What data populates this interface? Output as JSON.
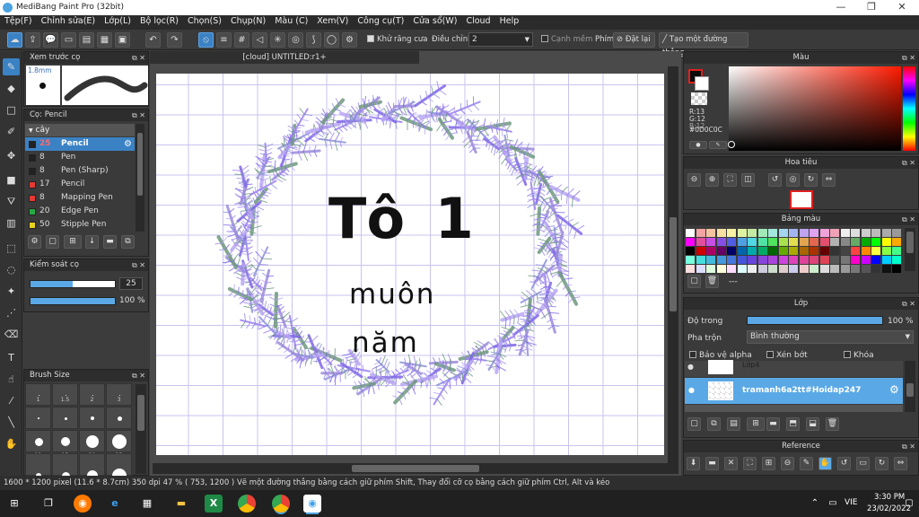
{
  "title_bar": {
    "title": "MediBang Paint Pro (32bit)",
    "minimize": "—",
    "maximize": "❐",
    "close": "✕"
  },
  "menu": [
    "Tệp(F)",
    "Chỉnh sửa(E)",
    "Lớp(L)",
    "Bộ lọc(R)",
    "Chọn(S)",
    "Chụp(N)",
    "Màu (C)",
    "Xem(V)",
    "Công cụ(T)",
    "Cửa sổ(W)",
    "Cloud",
    "Help"
  ],
  "toolbar": {
    "antialias": "Khử răng cưa",
    "adjust_label": "Điều chỉnh",
    "adjust_value": "2",
    "edge": "Cạnh mềm",
    "key_label": "Phím",
    "reset": "Đặt lại",
    "new_line": "Tạo một đường thẳng"
  },
  "preview_panel": {
    "title": "Xem trước cọ",
    "size": "1.8mm"
  },
  "brush_panel": {
    "title": "Cọ: Pencil",
    "group": "cây",
    "items": [
      {
        "size": "25",
        "name": "Pencil",
        "color": "#222222",
        "selected": true
      },
      {
        "size": "8",
        "name": "Pen",
        "color": "#222222"
      },
      {
        "size": "8",
        "name": "Pen (Sharp)",
        "color": "#222222"
      },
      {
        "size": "17",
        "name": "Pencil",
        "color": "#e53935"
      },
      {
        "size": "8",
        "name": "Mapping Pen",
        "color": "#e53935"
      },
      {
        "size": "20",
        "name": "Edge Pen",
        "color": "#27a844"
      },
      {
        "size": "50",
        "name": "Stipple Pen",
        "color": "#e8d21e"
      }
    ]
  },
  "brush_control": {
    "title": "Kiểm soát cọ",
    "size_value": "25",
    "size_fraction": 0.5,
    "opacity_value": "100 %",
    "opacity_fraction": 1.0
  },
  "brush_size": {
    "title": "Brush Size",
    "row1": [
      "1",
      "1.5",
      "2",
      "3"
    ],
    "row3": [
      "12",
      "15",
      "20",
      "25"
    ]
  },
  "canvas": {
    "tab": "[cloud] UNTITLED:r1+",
    "text_line1": "Tô 1",
    "text_line2": "muôn",
    "text_line3": "năm"
  },
  "color_panel": {
    "title": "Màu",
    "r": "R:13",
    "g": "G:12",
    "b": "B:12",
    "hex": "#0D0C0C",
    "fg": "#0d0c0c"
  },
  "navigator": {
    "title": "Hoa tiêu"
  },
  "palette": {
    "title": "Bảng màu",
    "more": "---"
  },
  "layer_panel": {
    "title": "Lớp",
    "opacity_label": "Độ trong",
    "opacity_value": "100 %",
    "opacity_fraction": 1.0,
    "blend_label": "Pha trộn",
    "blend_value": "Bình thường",
    "protect": "Bảo vệ alpha",
    "clip": "Xén bớt",
    "lock": "Khóa",
    "layer_top": "Lớp4",
    "layer_selected": "tramanh6a2tt#Hoidap247"
  },
  "reference": {
    "title": "Reference"
  },
  "status": {
    "size": "1600 * 1200 pixel",
    "physical": "(11.6 * 8.7cm)",
    "dpi": "350 dpi",
    "zoom": "47 %",
    "coords": "( 753, 1200 )",
    "hint": "Vẽ một đường thẳng bằng cách giữ phím Shift, Thay đổi cỡ cọ bằng cách giữ phím Ctrl, Alt và kéo"
  },
  "taskbar": {
    "lang": "VIE",
    "time": "3:30 PM",
    "date": "23/02/2022"
  }
}
